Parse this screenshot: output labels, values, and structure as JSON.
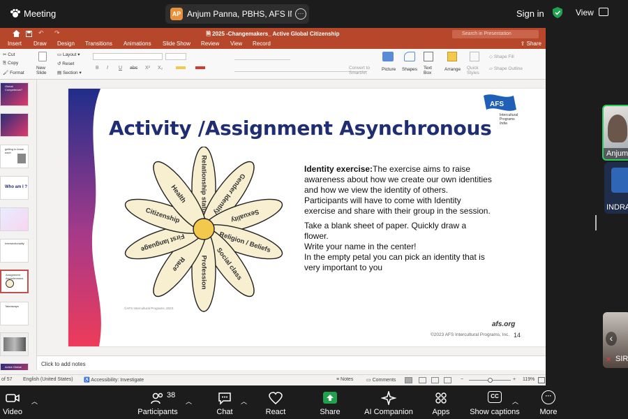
{
  "zoom": {
    "meeting_label": "Meeting",
    "sharer": {
      "initials": "AP",
      "name": "Anjum Panna, PBHS, AFS INDIA's",
      "more": "···"
    },
    "sign_in": "Sign in",
    "view": "View",
    "toolbar": [
      {
        "id": "video",
        "label": "Video",
        "icon": "video-camera-icon"
      },
      {
        "id": "participants",
        "label": "Participants",
        "count": "38",
        "icon": "participants-icon"
      },
      {
        "id": "chat",
        "label": "Chat",
        "icon": "chat-icon"
      },
      {
        "id": "react",
        "label": "React",
        "icon": "heart-icon"
      },
      {
        "id": "share",
        "label": "Share",
        "icon": "share-screen-icon"
      },
      {
        "id": "ai",
        "label": "AI Companion",
        "icon": "sparkle-icon"
      },
      {
        "id": "apps",
        "label": "Apps",
        "icon": "apps-icon"
      },
      {
        "id": "captions",
        "label": "Show captions",
        "icon": "cc-icon",
        "glyph": "CC"
      },
      {
        "id": "more",
        "label": "More",
        "icon": "more-icon",
        "glyph": "···"
      }
    ],
    "gallery": [
      {
        "name": "Anjum"
      },
      {
        "name": "INDRA"
      },
      {
        "name": "SIR"
      }
    ],
    "colors": {
      "accent_green": "#1fa14d",
      "share_green": "#1fa14d",
      "bar_bg": "#1c1c1c"
    }
  },
  "ppt": {
    "doc_title": "2025 -Changemakers_ Active Global Citizenship",
    "search_placeholder": "Search in Presentation",
    "share": "Share",
    "menu": [
      "Insert",
      "Draw",
      "Design",
      "Transitions",
      "Animations",
      "Slide Show",
      "Review",
      "View",
      "Record"
    ],
    "ribbon": {
      "cut": "Cut",
      "copy": "Copy",
      "format": "Format",
      "new_slide": "New Slide",
      "layout": "Layout",
      "reset": "Reset",
      "section": "Section",
      "convert_smartart": "Convert to SmartArt",
      "picture": "Picture",
      "shapes": "Shapes",
      "text_box": "Text Box",
      "arrange": "Arrange",
      "quick_styles": "Quick Styles",
      "shape_fill": "Shape Fill",
      "shape_outline": "Shape Outline",
      "format_glyphs": [
        "B",
        "I",
        "U",
        "abc",
        "X²",
        "X₂"
      ]
    },
    "thumbs": [
      {
        "text": "Global Competence?"
      },
      {
        "text": ""
      },
      {
        "text": "getting to know each"
      },
      {
        "text": "Who am I ?"
      },
      {
        "text": ""
      },
      {
        "text": "Intersectionality"
      },
      {
        "text": "Assignment Asynchronous"
      },
      {
        "text": "Takeaways"
      },
      {
        "text": ""
      },
      {
        "text": "Active Global"
      }
    ],
    "slide": {
      "title": "Activity /Assignment Asynchronous",
      "petals": [
        "Relationship status",
        "Gender Identity",
        "Sexuality",
        "Religion / Beliefs",
        "Social class",
        "Profession",
        "Race",
        "First language",
        "Citizenship",
        "Health"
      ],
      "identity_label": "Identity exercise:",
      "identity_text": "The exercise aims to raise awareness about how we create our own identities and how we view the identity of others. Participants will have to come with Identity exercise and share with their group in the session.",
      "instructions": [
        "Take a blank sheet of paper. Quickly draw a flower.",
        "Write your name in the center!",
        "In the empty petal you can pick an identity that is very important to you"
      ],
      "flower_copyright": "©AFS Intercultural Programs, 2023.",
      "website": "afs.org",
      "footer_copyright": "©2023 AFS Intercultural Programs, Inc.",
      "slide_number": "14",
      "logo": {
        "line1": "Intercultural",
        "line2": "Programs",
        "line3": "India"
      }
    },
    "notes_placeholder": "Click to add notes",
    "status": {
      "slide_count": "of 57",
      "language": "English (United States)",
      "accessibility": "Accessibility: Investigate",
      "notes": "Notes",
      "comments": "Comments",
      "zoom": "119%"
    },
    "colors": {
      "title_bar": "#b7472a",
      "slide_title": "#1f2e73",
      "petal_fill": "#f7efcf",
      "center_fill": "#f2c94c"
    }
  }
}
